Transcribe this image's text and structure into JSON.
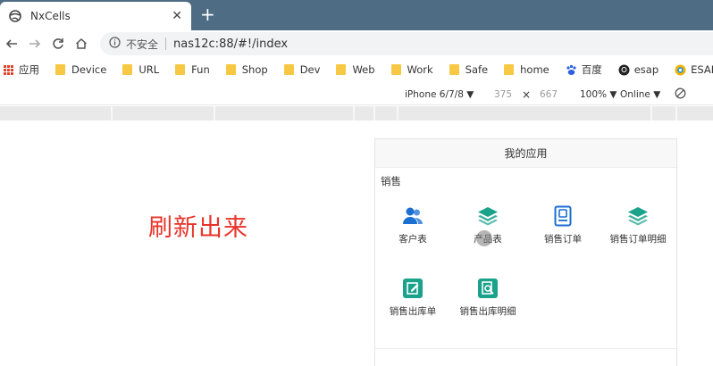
{
  "browser": {
    "tab_title": "NxCells",
    "tab_close": "✕",
    "new_tab": "+",
    "security_label": "不安全",
    "url": "nas12c:88/#!/index"
  },
  "bookmarks": [
    {
      "kind": "apps",
      "label": "应用"
    },
    {
      "kind": "folder",
      "label": "Device"
    },
    {
      "kind": "folder",
      "label": "URL"
    },
    {
      "kind": "folder",
      "label": "Fun"
    },
    {
      "kind": "folder",
      "label": "Shop"
    },
    {
      "kind": "folder",
      "label": "Dev"
    },
    {
      "kind": "folder",
      "label": "Web"
    },
    {
      "kind": "folder",
      "label": "Work"
    },
    {
      "kind": "folder",
      "label": "Safe"
    },
    {
      "kind": "folder",
      "label": "home"
    },
    {
      "kind": "baidu",
      "label": "百度"
    },
    {
      "kind": "github",
      "label": "esap"
    },
    {
      "kind": "esap",
      "label": "ESAP部"
    }
  ],
  "devtools": {
    "device": "iPhone 6/7/8 ▼",
    "width": "375",
    "times": "×",
    "height": "667",
    "zoom": "100% ▼",
    "network": "Online ▼"
  },
  "annotation": "刷新出来",
  "app_panel": {
    "title": "我的应用",
    "section": "销售",
    "apps": [
      {
        "label": "客户表",
        "icon": "users-icon",
        "color": "#1a6fd1"
      },
      {
        "label": "产品表",
        "icon": "layers-icon",
        "color": "#1aa28b"
      },
      {
        "label": "销售订单",
        "icon": "document-icon",
        "color": "#1a6fd1"
      },
      {
        "label": "销售订单明细",
        "icon": "layers-icon",
        "color": "#1aa28b"
      },
      {
        "label": "销售出库单",
        "icon": "edit-icon",
        "color": "#1aa28b"
      },
      {
        "label": "销售出库明细",
        "icon": "search-doc-icon",
        "color": "#1aa28b"
      }
    ]
  }
}
